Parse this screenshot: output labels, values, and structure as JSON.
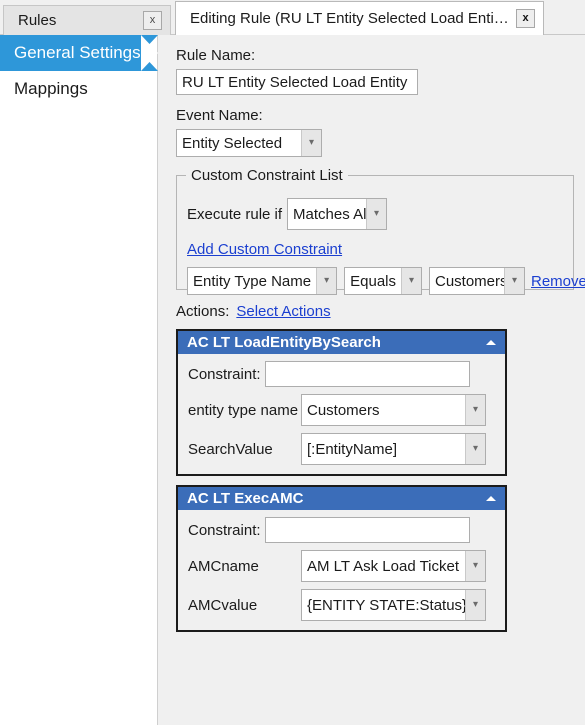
{
  "tabs": [
    {
      "label": "Rules",
      "close_label": "x",
      "active": false
    },
    {
      "label": "Editing Rule (RU LT Entity Selected Load Entity)",
      "close_label": "x",
      "active": true
    }
  ],
  "sidebar": {
    "items": [
      {
        "label": "General Settings",
        "selected": true
      },
      {
        "label": "Mappings",
        "selected": false
      }
    ]
  },
  "form": {
    "rule_name_label": "Rule Name:",
    "rule_name_value": "RU LT Entity Selected Load Entity",
    "event_name_label": "Event Name:",
    "event_name_value": "Entity Selected"
  },
  "constraint_group": {
    "title": "Custom Constraint List",
    "execute_label": "Execute rule if",
    "execute_value": "Matches All",
    "add_link": "Add Custom Constraint",
    "constraint_rows": [
      {
        "field": "Entity Type Name",
        "operator": "Equals",
        "value": "Customers",
        "remove_label": "Remove"
      }
    ]
  },
  "actions_section": {
    "label": "Actions:",
    "select_link": "Select Actions",
    "panels": [
      {
        "title": "AC LT LoadEntityBySearch",
        "collapse_icon": "caret-up-icon",
        "constraint_label": "Constraint:",
        "constraint_value": "",
        "fields": [
          {
            "label": "entity type name",
            "value": "Customers"
          },
          {
            "label": "SearchValue",
            "value": "[:EntityName]"
          }
        ]
      },
      {
        "title": "AC LT ExecAMC",
        "collapse_icon": "caret-up-icon",
        "constraint_label": "Constraint:",
        "constraint_value": "",
        "fields": [
          {
            "label": "AMCname",
            "value": "AM LT Ask Load Ticket"
          },
          {
            "label": "AMCvalue",
            "value": "{ENTITY STATE:Status}"
          }
        ]
      }
    ]
  },
  "colors": {
    "sidebar_selected": "#2e97d9",
    "action_header": "#3b6db9",
    "link": "#1b3fd0",
    "content_bg": "#f0f0f0"
  }
}
